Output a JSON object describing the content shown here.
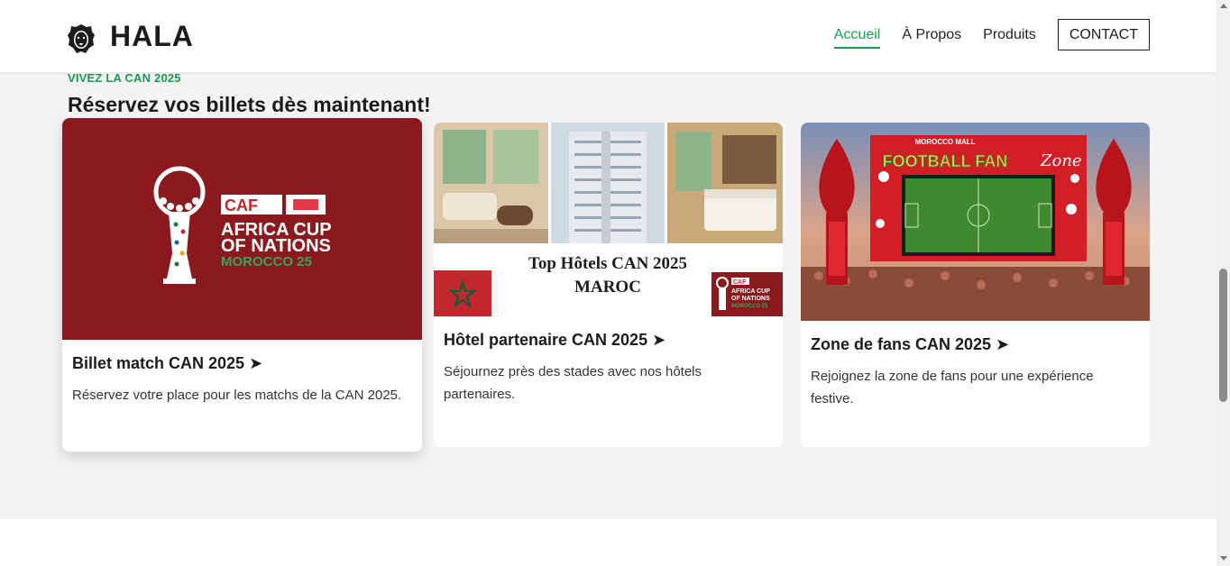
{
  "brand": {
    "name": "HALA",
    "logo_icon": "lion-head-icon"
  },
  "nav": {
    "items": [
      {
        "label": "Accueil",
        "active": true
      },
      {
        "label": "À Propos",
        "active": false
      },
      {
        "label": "Produits",
        "active": false
      }
    ],
    "contact_label": "CONTACT"
  },
  "section": {
    "eyebrow": "VIVEZ LA CAN 2025",
    "title": "Réservez vos billets dès maintenant!"
  },
  "cards": [
    {
      "title": "Billet match CAN 2025 ➤",
      "description": "Réservez votre place pour les matchs de la CAN 2025.",
      "image": {
        "caf": "CAF",
        "line1": "AFRICA CUP",
        "line2": "OF NATIONS",
        "line3": "MOROCCO 25"
      }
    },
    {
      "title": "Hôtel partenaire CAN 2025 ➤",
      "description": "Séjournez près des stades avec nos hôtels partenaires.",
      "image": {
        "heading1": "Top Hôtels CAN 2025",
        "heading2": "MAROC",
        "badge_caf": "CAF",
        "badge_line1": "AFRICA CUP",
        "badge_line2": "OF NATIONS",
        "badge_line3": "MOROCCO 25"
      }
    },
    {
      "title": "Zone de fans CAN 2025 ➤",
      "description": "Rejoignez la zone de fans pour une expérience festive.",
      "image": {
        "top": "MOROCCO MALL",
        "banner": "FOOTBALL FAN",
        "script": "Zone"
      }
    }
  ],
  "colors": {
    "accent_green": "#1a9a54",
    "maroon": "#8b1a1f",
    "morocco_red": "#c1272d",
    "morocco_green": "#006233"
  }
}
